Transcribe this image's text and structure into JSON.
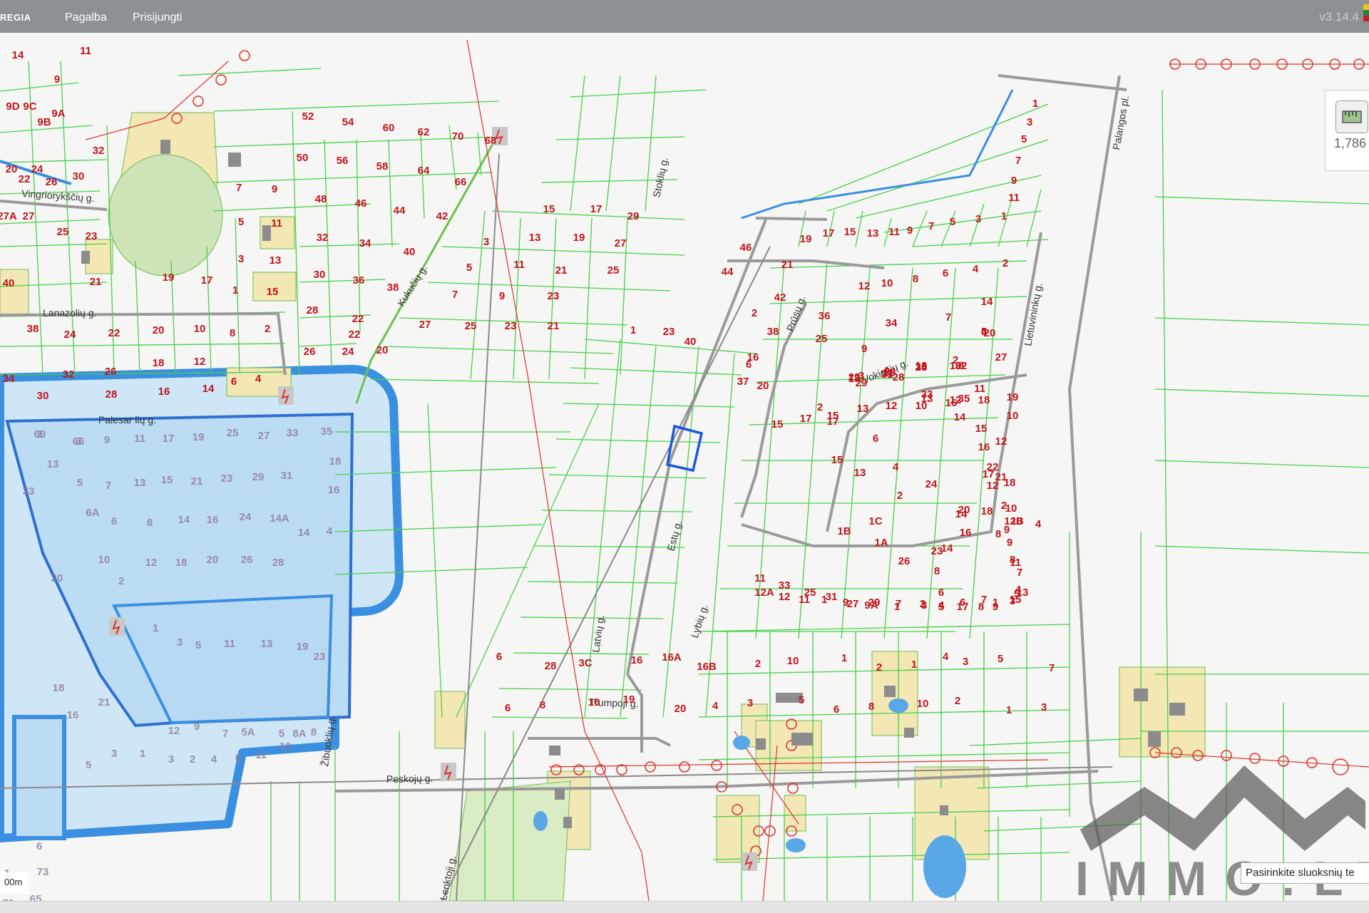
{
  "topbar": {
    "logo": "REGIA",
    "menu": [
      "Pagalba",
      "Prisijungti"
    ],
    "version": "v3.14.4"
  },
  "side_tool": {
    "value": "1,786"
  },
  "hint": "Pasirinkite sluoksnių te",
  "scale": "00m",
  "watermark": "IMMO.LT",
  "colors": {
    "parcel": "#47d04a",
    "label": "#c0141c",
    "road": "#9a9a9a",
    "water": "#3b8fe0",
    "water_fill": "#cfe6f7",
    "highlight": "#1a56e0",
    "power_line": "#e03030"
  },
  "streets": [
    "Vingriorykščių g.",
    "Lanazolių g.",
    "Kukučių g.",
    "Stoklių g.",
    "Palangos pl.",
    "Lietuvininkų g.",
    "Prūsų g.",
    "Vokiečių g.",
    "Estų g.",
    "Lybių g.",
    "Latvių g.",
    "Trumpoji g.",
    "Peskojų g.",
    "Lenktoji g.",
    "Palesar lių g.",
    "Žibuoklių g."
  ],
  "parcel_labels": [
    "14",
    "11",
    "9",
    "9D",
    "9C",
    "9A",
    "9B",
    "32",
    "20",
    "24",
    "26",
    "22",
    "30",
    "27A",
    "27",
    "25",
    "23",
    "40",
    "21",
    "38",
    "24",
    "22",
    "20",
    "10",
    "8",
    "2",
    "18",
    "12",
    "34",
    "32",
    "26",
    "30",
    "28",
    "16",
    "14",
    "6",
    "4",
    "52",
    "54",
    "60",
    "62",
    "70",
    "68",
    "50",
    "56",
    "58",
    "64",
    "66",
    "48",
    "46",
    "44",
    "42",
    "32",
    "34",
    "40",
    "30",
    "36",
    "38",
    "28",
    "22",
    "26",
    "24",
    "7",
    "9",
    "5",
    "11",
    "3",
    "13",
    "1",
    "15",
    "19",
    "17",
    "15",
    "17",
    "29",
    "3",
    "13",
    "19",
    "27",
    "5",
    "11",
    "21",
    "25",
    "7",
    "9",
    "23",
    "27",
    "25",
    "23",
    "21",
    "22",
    "20",
    "1",
    "3",
    "5",
    "7",
    "9",
    "11",
    "19",
    "17",
    "15",
    "13",
    "11",
    "9",
    "7",
    "5",
    "3",
    "1",
    "46",
    "21",
    "44",
    "2",
    "4",
    "6",
    "8",
    "10",
    "12",
    "14",
    "2",
    "1",
    "42",
    "23",
    "40",
    "38",
    "36",
    "34",
    "25",
    "16",
    "9",
    "7",
    "5",
    "3",
    "28",
    "30",
    "32",
    "27",
    "18",
    "11",
    "13",
    "8",
    "6",
    "4",
    "2",
    "26",
    "24",
    "22",
    "20",
    "29",
    "31",
    "33",
    "35",
    "37",
    "20",
    "15",
    "17",
    "15",
    "13",
    "12",
    "10",
    "16",
    "18",
    "19",
    "10",
    "12",
    "21",
    "14",
    "23",
    "8",
    "6",
    "4",
    "2",
    "17",
    "15",
    "13",
    "6",
    "4",
    "2",
    "1C",
    "1B",
    "1A",
    "26",
    "24",
    "22",
    "20",
    "18",
    "16",
    "14",
    "8",
    "10",
    "12",
    "4",
    "2",
    "18",
    "17",
    "16",
    "15",
    "14",
    "13",
    "12",
    "11",
    "10",
    "9",
    "11",
    "13",
    "15",
    "9",
    "7",
    "17",
    "5",
    "3",
    "1",
    "29",
    "27",
    "31",
    "25",
    "33",
    "11",
    "13",
    "9",
    "7",
    "5",
    "3",
    "1",
    "8",
    "6",
    "4",
    "2",
    "7",
    "9A",
    "9",
    "1",
    "11",
    "12",
    "12A",
    "12B",
    "8",
    "4",
    "6",
    "28",
    "3C",
    "16",
    "16A",
    "16B",
    "2",
    "10",
    "1",
    "2",
    "1",
    "3",
    "5",
    "7",
    "6",
    "8",
    "10",
    "19",
    "20",
    "4",
    "3",
    "5",
    "6",
    "8",
    "10",
    "2",
    "1",
    "3"
  ],
  "faded_labels": [
    "1",
    "3",
    "9",
    "11",
    "17",
    "19",
    "25",
    "27",
    "33",
    "35",
    "13",
    "18",
    "5",
    "7",
    "13",
    "15",
    "21",
    "23",
    "29",
    "31",
    "16",
    "33",
    "6A",
    "6",
    "8",
    "14",
    "16",
    "24",
    "14A",
    "14",
    "4",
    "10",
    "12",
    "18",
    "20",
    "26",
    "28",
    "20",
    "2",
    "1",
    "3",
    "5",
    "11",
    "13",
    "19",
    "23",
    "18",
    "16",
    "21",
    "12",
    "9",
    "7",
    "5A",
    "5",
    "8A",
    "8",
    "10",
    "11",
    "6",
    "4",
    "2",
    "3",
    "1",
    "3",
    "5",
    "6",
    "1",
    "73",
    "65",
    "71",
    "69",
    "66"
  ]
}
